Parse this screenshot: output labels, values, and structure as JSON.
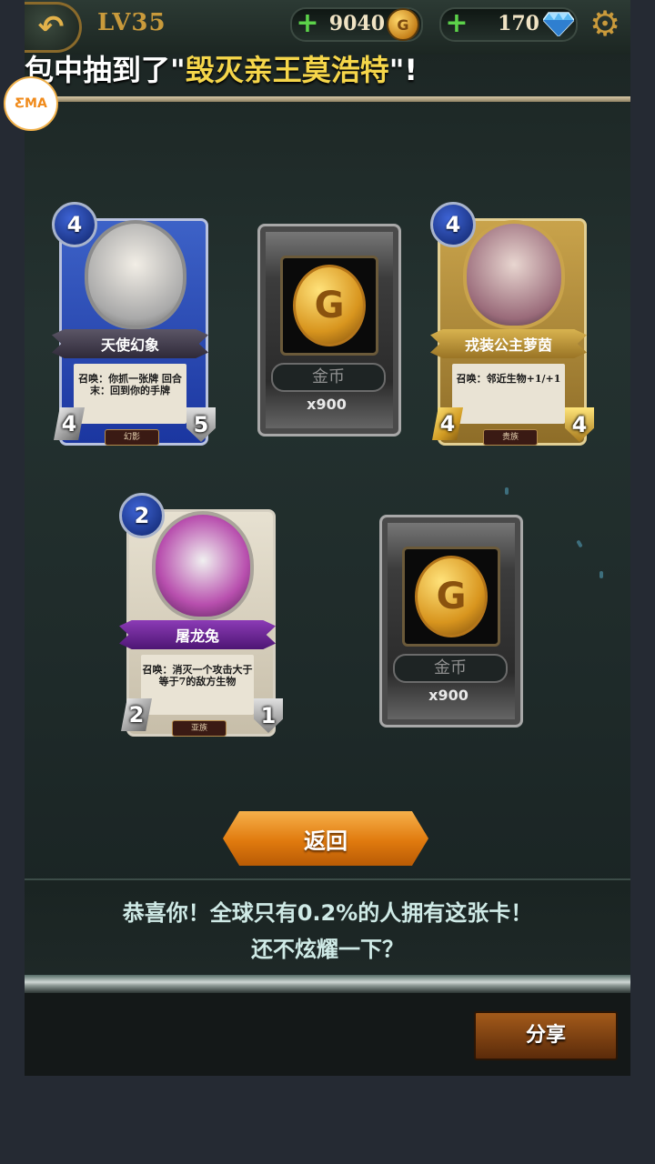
{
  "header": {
    "level": "LV35",
    "coins": "9040",
    "gems": "170"
  },
  "marquee": {
    "prefix": "包中抽到了\"",
    "highlight": "毁灭亲王莫浩特",
    "suffix": "\"!"
  },
  "watermark": "ƸMA",
  "cards": [
    {
      "name": "天使幻象",
      "cost": "4",
      "attack": "4",
      "health": "5",
      "text": "召唤：你抓一张牌 回合末：回到你的手牌",
      "tribe": "幻影"
    },
    {
      "name": "戎装公主萝茵",
      "cost": "4",
      "attack": "4",
      "health": "4",
      "text": "召唤：邻近生物+1/+1",
      "tribe": "贵族"
    },
    {
      "name": "屠龙兔",
      "cost": "2",
      "attack": "2",
      "health": "1",
      "text": "召唤：消灭一个攻击大于等于7的敌方生物",
      "tribe": "亚族"
    }
  ],
  "rewards": [
    {
      "name": "金币",
      "quantity": "x900"
    },
    {
      "name": "金币",
      "quantity": "x900"
    }
  ],
  "buttons": {
    "return": "返回",
    "share": "分享"
  },
  "congrats": {
    "line1": "恭喜你！全球只有0.2%的人拥有这张卡！",
    "line2": "还不炫耀一下？"
  },
  "colors": {
    "accent": "#e07a0e",
    "highlight": "#f5d64a",
    "level": "#c99a3b"
  }
}
